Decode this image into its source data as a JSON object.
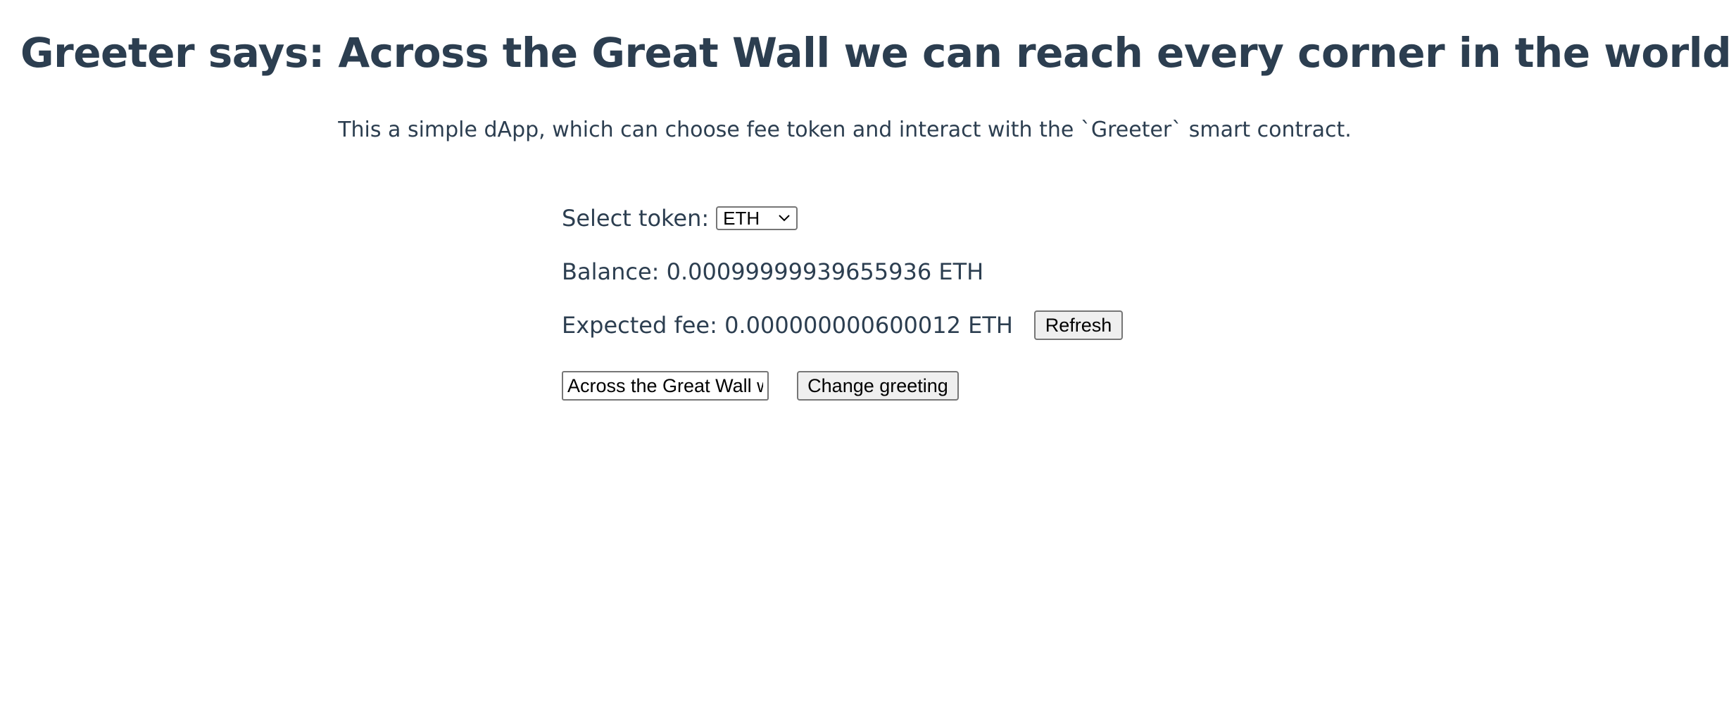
{
  "header": {
    "title": "Greeter says: Across the Great Wall we can reach every corner in the world",
    "emoji_icon": "waving-hand-icon",
    "subtitle": "This a simple dApp, which can choose fee token and interact with the `Greeter` smart contract."
  },
  "token": {
    "label": "Select token:",
    "selected": "ETH"
  },
  "balance": {
    "text": "Balance: 0.00099999939655936 ETH"
  },
  "fee": {
    "text": "Expected fee: 0.000000000600012 ETH",
    "refresh_label": "Refresh"
  },
  "greeting": {
    "input_value": "Across the Great Wall we can reach every corner in the world",
    "change_label": "Change greeting"
  },
  "colors": {
    "text": "#2c3e50",
    "button_bg": "#efefef",
    "border": "#767676"
  }
}
